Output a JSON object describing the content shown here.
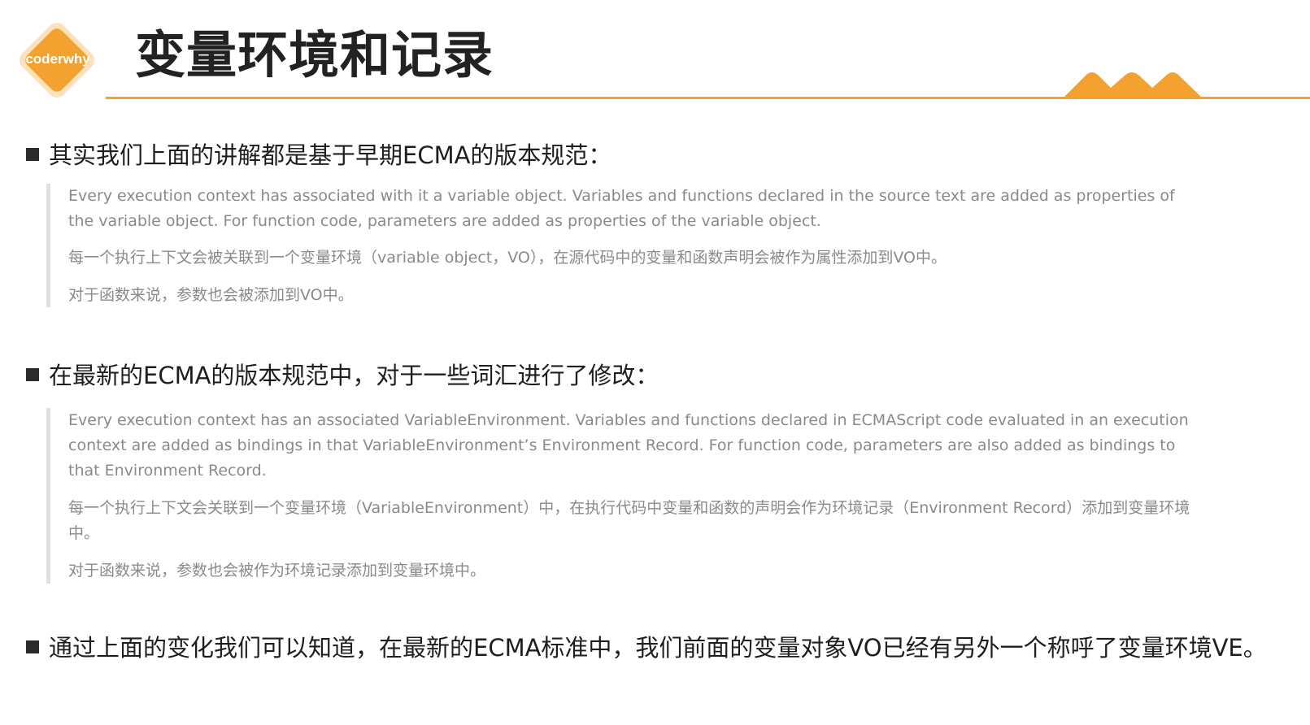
{
  "brand": {
    "logo_text": "coderwhy",
    "accent_color": "#f3a12f"
  },
  "title": "变量环境和记录",
  "sections": [
    {
      "heading": "其实我们上面的讲解都是基于早期ECMA的版本规范：",
      "quote": {
        "english": "Every execution context has associated with it a variable object. Variables and functions declared in the source text are added as properties of the variable object. For function code, parameters are added as properties of the variable object.",
        "chinese_1": "每一个执行上下文会被关联到一个变量环境（variable object，VO），在源代码中的变量和函数声明会被作为属性添加到VO中。",
        "chinese_2": "对于函数来说，参数也会被添加到VO中。"
      }
    },
    {
      "heading": "在最新的ECMA的版本规范中，对于一些词汇进行了修改：",
      "quote": {
        "english": "Every execution context has an associated VariableEnvironment. Variables and functions declared in ECMAScript code evaluated in an execution context are added as bindings in that VariableEnvironment’s Environment Record. For function code, parameters are also added as bindings to that Environment Record.",
        "chinese_1": "每一个执行上下文会关联到一个变量环境（VariableEnvironment）中，在执行代码中变量和函数的声明会作为环境记录（Environment Record）添加到变量环境中。",
        "chinese_2": "对于函数来说，参数也会被作为环境记录添加到变量环境中。"
      }
    },
    {
      "heading": "通过上面的变化我们可以知道，在最新的ECMA标准中，我们前面的变量对象VO已经有另外一个称呼了变量环境VE。"
    }
  ]
}
